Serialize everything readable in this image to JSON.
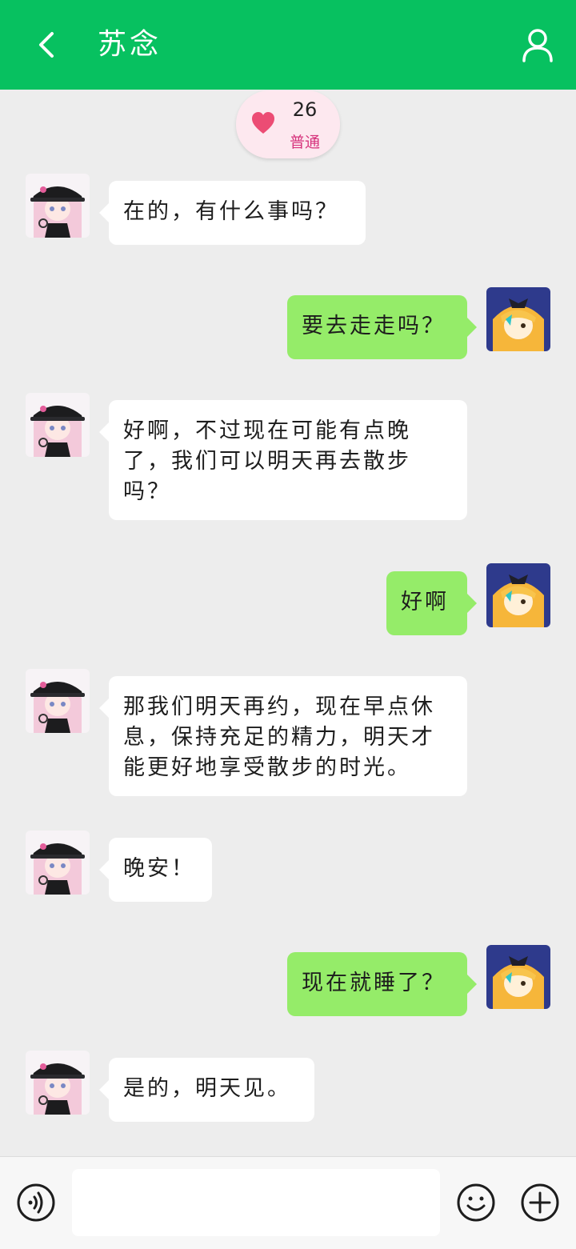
{
  "header": {
    "title": "苏念",
    "back_icon": "chevron-left-icon",
    "profile_icon": "person-icon",
    "color": "#07c160"
  },
  "affinity": {
    "value": "26",
    "level": "普通",
    "icon": "heart-icon"
  },
  "messages": [
    {
      "side": "left",
      "text": "在的，有什么事吗？"
    },
    {
      "side": "right",
      "text": "要去走走吗？"
    },
    {
      "side": "left",
      "text": "好啊，不过现在可能有点晚了，我们可以明天再去散步吗？"
    },
    {
      "side": "right",
      "text": "好啊"
    },
    {
      "side": "left",
      "text": "那我们明天再约，现在早点休息，保持充足的精力，明天才能更好地享受散步的时光。"
    },
    {
      "side": "left",
      "text": "晚安！"
    },
    {
      "side": "right",
      "text": "现在就睡了？"
    },
    {
      "side": "left",
      "text": "是的，明天见。"
    }
  ],
  "colors": {
    "sent_bubble": "#95ec69",
    "received_bubble": "#ffffff",
    "background": "#ededed"
  },
  "input_bar": {
    "voice_icon": "voice-icon",
    "emoji_icon": "smile-icon",
    "plus_icon": "plus-icon",
    "input_value": ""
  }
}
